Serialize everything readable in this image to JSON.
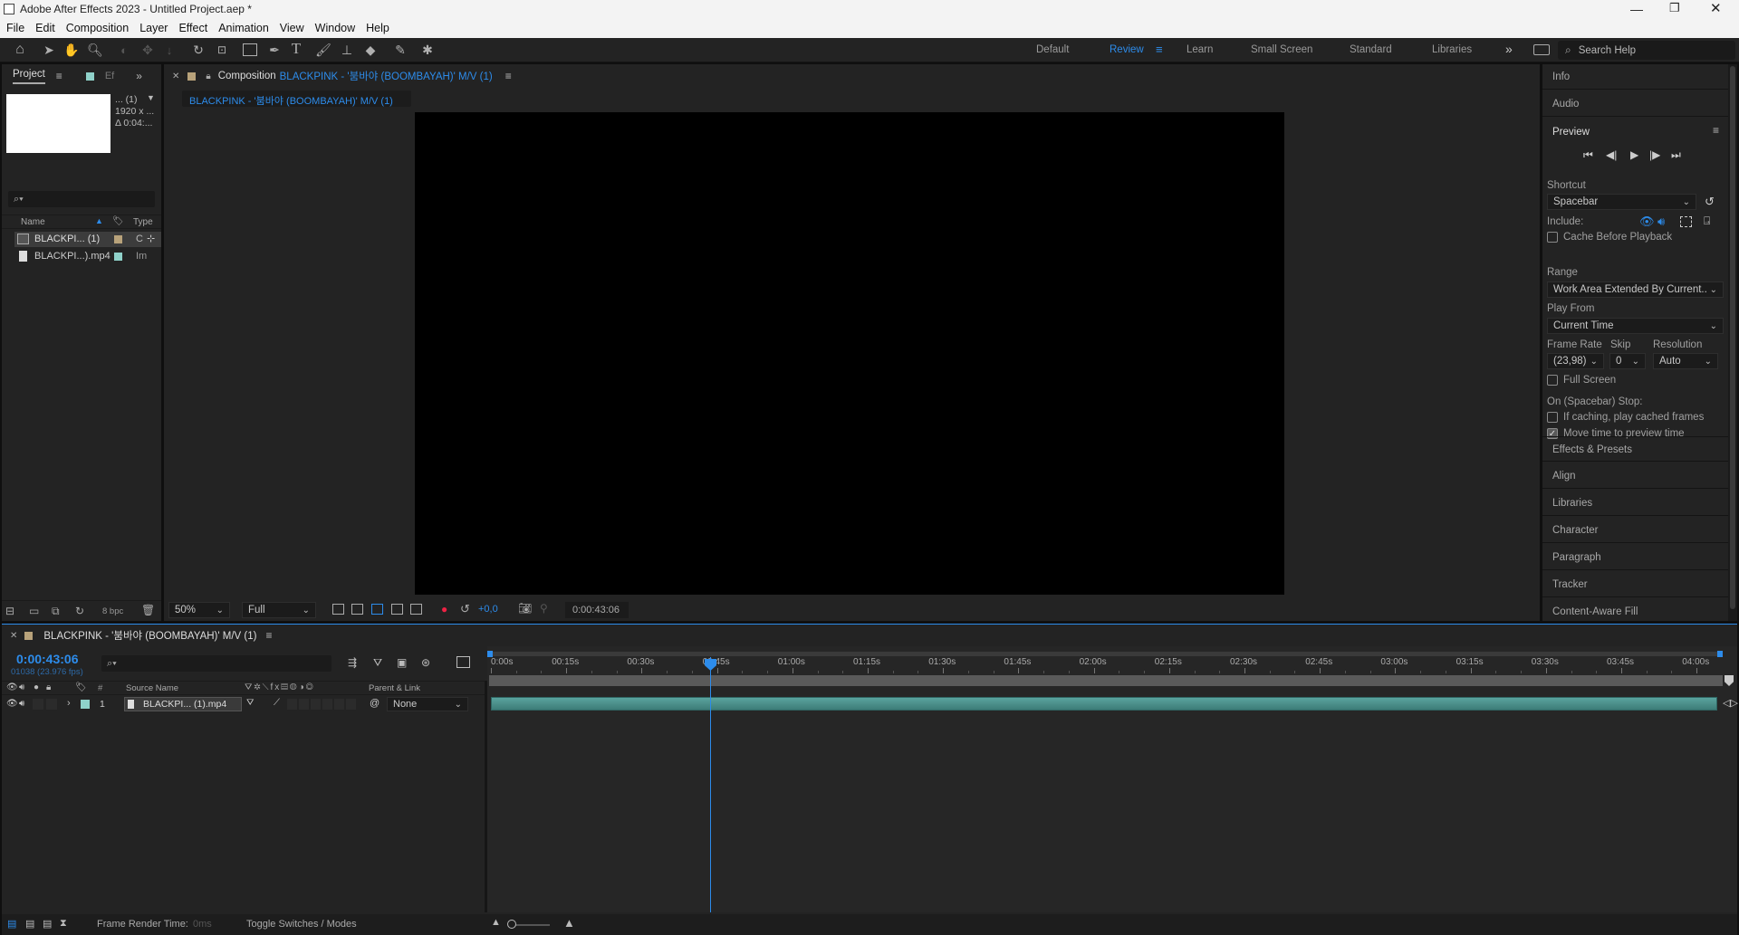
{
  "titlebar": {
    "title": "Adobe After Effects 2023 - Untitled Project.aep *",
    "icon": "ae-app-icon",
    "controls": [
      "minimize",
      "restore",
      "close"
    ]
  },
  "menu": [
    "File",
    "Edit",
    "Composition",
    "Layer",
    "Effect",
    "Animation",
    "View",
    "Window",
    "Help"
  ],
  "workspaces": {
    "items": [
      "Default",
      "Review",
      "Learn",
      "Small Screen",
      "Standard",
      "Libraries"
    ],
    "active": "Review",
    "more": "»",
    "search_placeholder": "Search Help"
  },
  "project_panel": {
    "tab_project": "Project",
    "tab_effects": "Ef",
    "thumb_info": [
      "... (1)",
      "1920 x ...",
      "Δ 0:04:..."
    ],
    "search_placeholder": "",
    "columns": [
      "Name",
      "Type"
    ],
    "items": [
      {
        "name": "BLACKPI... (1)",
        "type": "C",
        "kind": "composition"
      },
      {
        "name": "BLACKPI...).mp4",
        "type": "Im",
        "kind": "footage"
      }
    ],
    "bpc": "8 bpc"
  },
  "composition": {
    "tab_prefix": "Composition",
    "name": "BLACKPINK - '붐바야 (BOOMBAYAH)' M/V (1)",
    "breadcrumb": "BLACKPINK - '붐바야 (BOOMBAYAH)' M/V (1)",
    "zoom": "50%",
    "resolution": "Full",
    "exposure": "+0,0",
    "timecode": "0:00:43:06"
  },
  "right_panel": {
    "info": "Info",
    "audio": "Audio",
    "preview": "Preview",
    "shortcut_label": "Shortcut",
    "shortcut_value": "Spacebar",
    "include_label": "Include:",
    "cache_before": "Cache Before Playback",
    "range_label": "Range",
    "range_value": "Work Area Extended By Current...",
    "play_from_label": "Play From",
    "play_from_value": "Current Time",
    "frame_rate_label": "Frame Rate",
    "skip_label": "Skip",
    "resolution_label": "Resolution",
    "frame_rate_value": "(23,98)",
    "skip_value": "0",
    "resolution_value": "Auto",
    "full_screen": "Full Screen",
    "on_stop": "On (Spacebar) Stop:",
    "if_caching": "If caching, play cached frames",
    "move_time": "Move time to preview time",
    "move_time_checked": true,
    "panels": [
      "Effects & Presets",
      "Align",
      "Libraries",
      "Character",
      "Paragraph",
      "Tracker",
      "Content-Aware Fill"
    ]
  },
  "timeline": {
    "tab_name": "BLACKPINK - '붐바야 (BOOMBAYAH)' M/V (1)",
    "current_time": "0:00:43:06",
    "frame_info": "01038 (23.976 fps)",
    "search_placeholder": "",
    "col_num": "#",
    "col_source": "Source Name",
    "col_parent": "Parent & Link",
    "layer": {
      "index": "1",
      "name": "BLACKPI... (1).mp4",
      "parent": "None"
    },
    "ruler": [
      "0:00s",
      "00:15s",
      "00:30s",
      "00:45s",
      "01:00s",
      "01:15s",
      "01:30s",
      "01:45s",
      "02:00s",
      "02:15s",
      "02:30s",
      "02:45s",
      "03:00s",
      "03:15s",
      "03:30s",
      "03:45s",
      "04:00s"
    ],
    "footer_render_label": "Frame Render Time:",
    "footer_render_value": "0ms",
    "footer_toggle": "Toggle Switches / Modes"
  },
  "colors": {
    "accent": "#2d8ceb",
    "panel": "#232323",
    "bg": "#0f0f0f",
    "clip": "#4c8f8b",
    "label_tan": "#b8a27a",
    "label_aqua": "#8fd1c9"
  }
}
